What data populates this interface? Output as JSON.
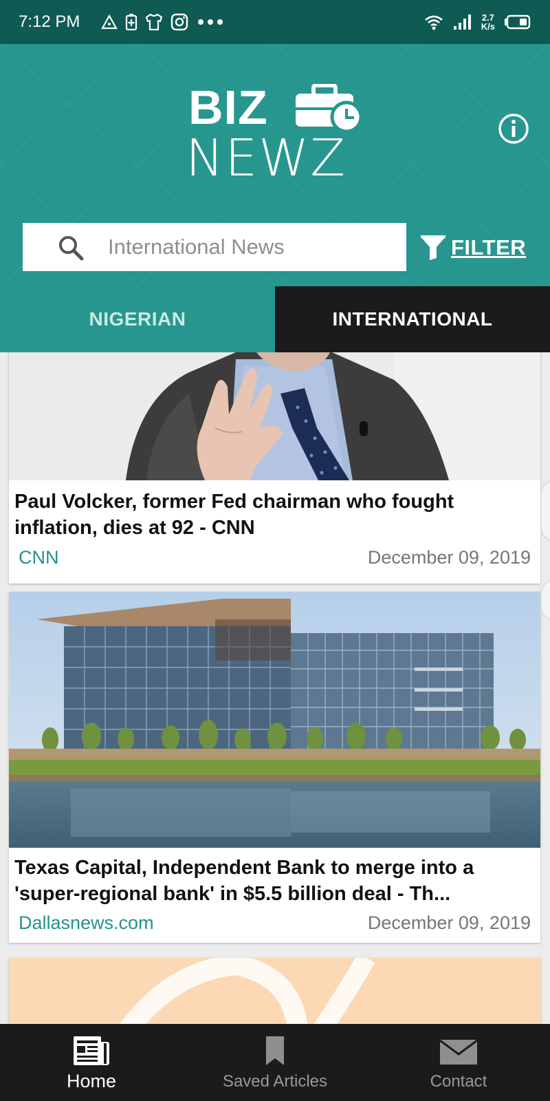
{
  "status_bar": {
    "time": "7:12 PM",
    "net_speed_top": "2.7",
    "net_speed_bottom": "K/s"
  },
  "header": {
    "logo_top": "BIZ",
    "logo_bottom": "NEWZ",
    "search_placeholder": "International News",
    "filter_label": "FILTER"
  },
  "tabs": [
    {
      "label": "NIGERIAN",
      "active": false
    },
    {
      "label": "INTERNATIONAL",
      "active": true
    }
  ],
  "articles": [
    {
      "title": "Paul Volcker, former Fed chairman who fought inflation, dies at 92 - CNN",
      "source": "CNN",
      "date": "December 09, 2019"
    },
    {
      "title": "Texas Capital, Independent Bank to merge into a 'super-regional bank' in $5.5 billion deal - Th...",
      "source": "Dallasnews.com",
      "date": "December 09, 2019"
    }
  ],
  "bottom_nav": [
    {
      "label": "Home",
      "icon": "newspaper-icon",
      "active": true
    },
    {
      "label": "Saved Articles",
      "icon": "bookmark-icon",
      "active": false
    },
    {
      "label": "Contact",
      "icon": "envelope-icon",
      "active": false
    }
  ],
  "colors": {
    "status_bar": "#0f5a52",
    "header_teal": "#27968f",
    "tab_active_bg": "#1b1b1b",
    "source_text": "#23938b",
    "bottom_nav_bg": "#1b1b1b"
  }
}
